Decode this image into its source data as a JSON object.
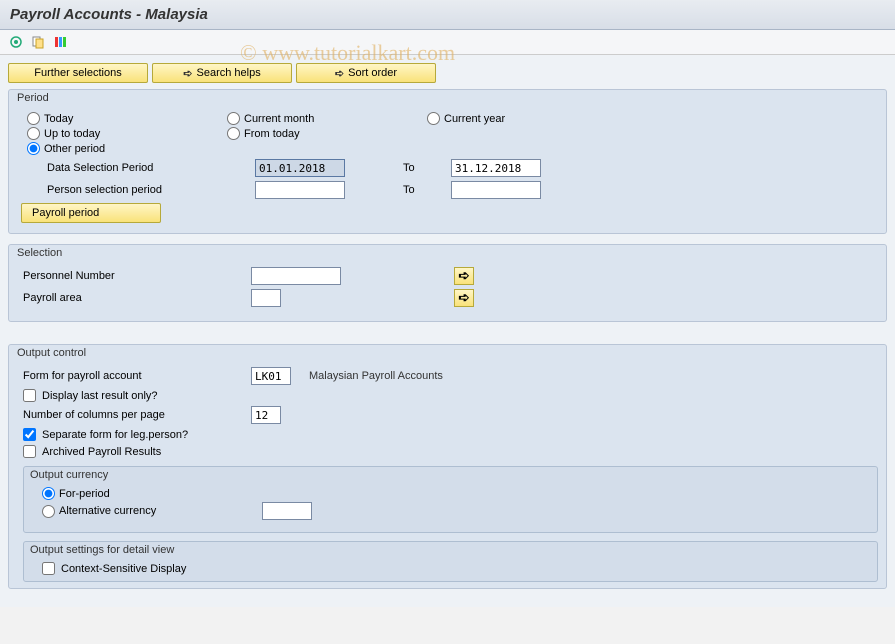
{
  "title": "Payroll Accounts - Malaysia",
  "watermark": "© www.tutorialkart.com",
  "toolbar_buttons": {
    "further_selections": "Further selections",
    "search_helps": "Search helps",
    "sort_order": "Sort order"
  },
  "period": {
    "group_title": "Period",
    "radios": {
      "today": "Today",
      "current_month": "Current month",
      "current_year": "Current year",
      "up_to_today": "Up to today",
      "from_today": "From today",
      "other_period": "Other period"
    },
    "data_selection_label": "Data Selection Period",
    "data_selection_from": "01.01.2018",
    "data_selection_to": "31.12.2018",
    "to_label": "To",
    "person_selection_label": "Person selection period",
    "person_selection_from": "",
    "person_selection_to": "",
    "payroll_period_btn": "Payroll period"
  },
  "selection": {
    "group_title": "Selection",
    "personnel_number_label": "Personnel Number",
    "personnel_number_value": "",
    "payroll_area_label": "Payroll area",
    "payroll_area_value": ""
  },
  "output": {
    "group_title": "Output control",
    "form_label": "Form for payroll account",
    "form_value": "LK01",
    "form_desc": "Malaysian Payroll Accounts",
    "display_last_label": "Display last result only?",
    "num_cols_label": "Number of columns per page",
    "num_cols_value": "12",
    "separate_form_label": "Separate form for leg.person?",
    "archived_label": "Archived Payroll Results",
    "currency": {
      "title": "Output currency",
      "for_period": "For-period",
      "alternative": "Alternative currency",
      "alt_value": ""
    },
    "detail_view": {
      "title": "Output settings for detail view",
      "context_sensitive": "Context-Sensitive Display"
    }
  }
}
